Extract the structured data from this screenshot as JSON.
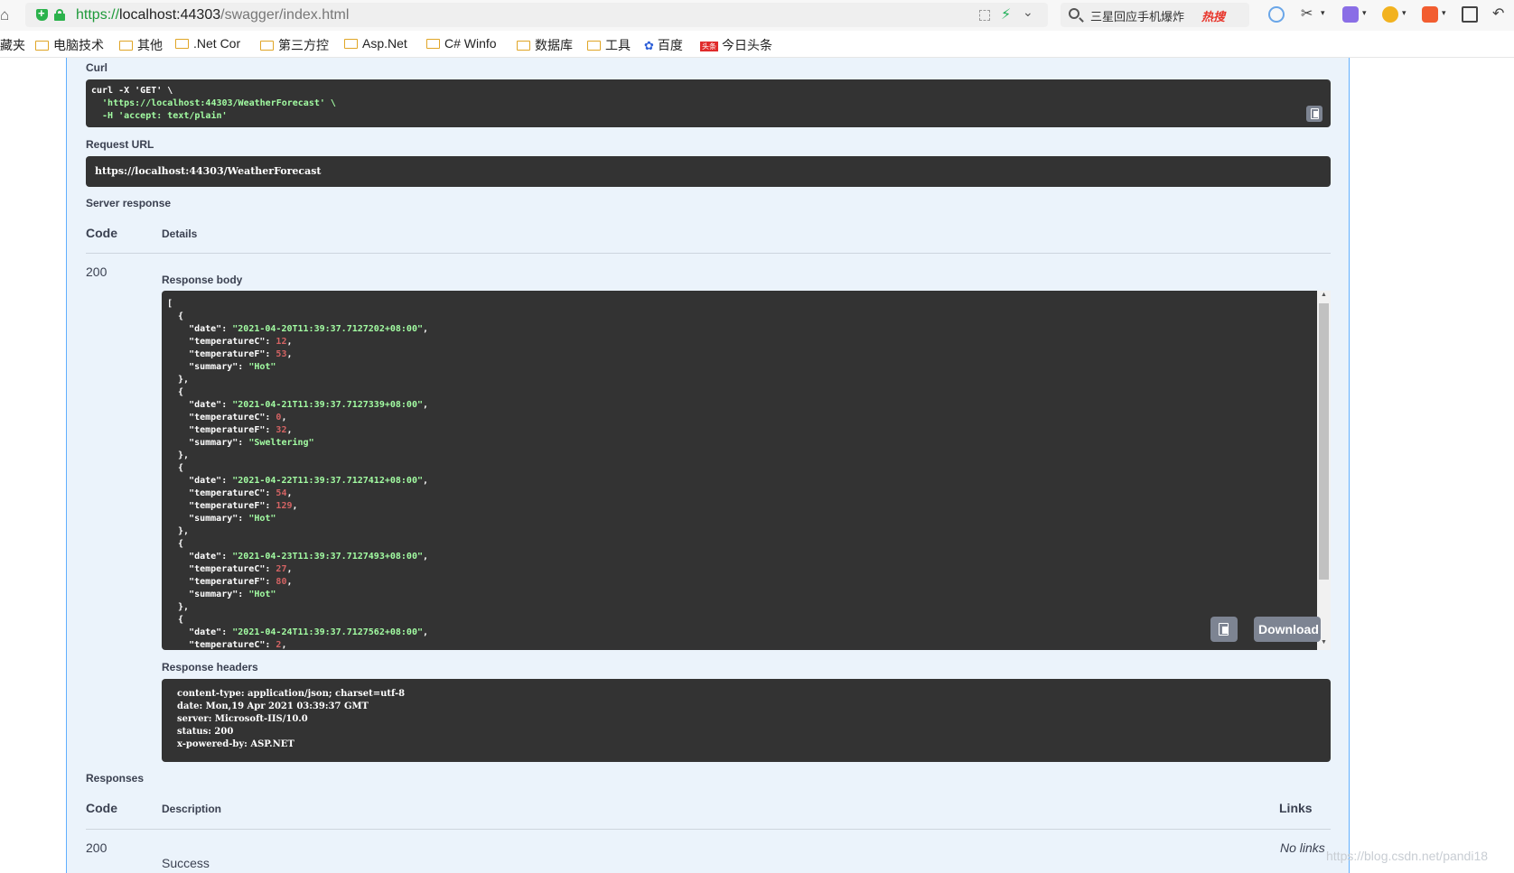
{
  "browser": {
    "url_scheme": "https://",
    "url_host": "localhost:44303",
    "url_path": "/swagger/index.html",
    "search_query": "三星回应手机爆炸",
    "search_hot": "热搜"
  },
  "bookmarks": [
    {
      "label": "藏夹",
      "icon": "none"
    },
    {
      "label": "电脑技术",
      "icon": "folder"
    },
    {
      "label": "其他",
      "icon": "folder"
    },
    {
      "label": ".Net Cor",
      "icon": "folder"
    },
    {
      "label": "第三方控",
      "icon": "folder"
    },
    {
      "label": "Asp.Net",
      "icon": "folder"
    },
    {
      "label": "C# Winfo",
      "icon": "folder"
    },
    {
      "label": "数据库",
      "icon": "folder"
    },
    {
      "label": "工具",
      "icon": "folder"
    },
    {
      "label": "百度",
      "icon": "baidu"
    },
    {
      "label": "今日头条",
      "icon": "toutiao"
    }
  ],
  "curl": {
    "label": "Curl",
    "line1": "curl -X 'GET' \\",
    "line2": "  'https://localhost:44303/WeatherForecast' \\",
    "line3": "  -H 'accept: text/plain'"
  },
  "request_url": {
    "label": "Request URL",
    "value": "https://localhost:44303/WeatherForecast"
  },
  "server_response": {
    "label": "Server response",
    "code_header": "Code",
    "details_header": "Details",
    "code": "200",
    "body_label": "Response body",
    "body_items": [
      {
        "date": "2021-04-20T11:39:37.7127202+08:00",
        "temperatureC": "12",
        "temperatureF": "53",
        "summary": "Hot"
      },
      {
        "date": "2021-04-21T11:39:37.7127339+08:00",
        "temperatureC": "0",
        "temperatureF": "32",
        "summary": "Sweltering"
      },
      {
        "date": "2021-04-22T11:39:37.7127412+08:00",
        "temperatureC": "54",
        "temperatureF": "129",
        "summary": "Hot"
      },
      {
        "date": "2021-04-23T11:39:37.7127493+08:00",
        "temperatureC": "27",
        "temperatureF": "80",
        "summary": "Hot"
      },
      {
        "date": "2021-04-24T11:39:37.7127562+08:00",
        "temperatureC": "2"
      }
    ],
    "download_label": "Download",
    "headers_label": "Response headers",
    "headers": [
      "content-type: application/json; charset=utf-8",
      "date: Mon,19 Apr 2021 03:39:37 GMT",
      "server: Microsoft-IIS/10.0",
      "status: 200",
      "x-powered-by: ASP.NET"
    ]
  },
  "responses": {
    "label": "Responses",
    "code_header": "Code",
    "description_header": "Description",
    "links_header": "Links",
    "code": "200",
    "description": "Success",
    "links": "No links"
  },
  "watermark": "https://blog.csdn.net/pandi18",
  "colors": {
    "panel_bg": "#ebf3fb",
    "panel_border": "#61affe",
    "code_bg": "#333333",
    "string": "#a2fca2",
    "number": "#d36363",
    "button": "#7d8492"
  }
}
